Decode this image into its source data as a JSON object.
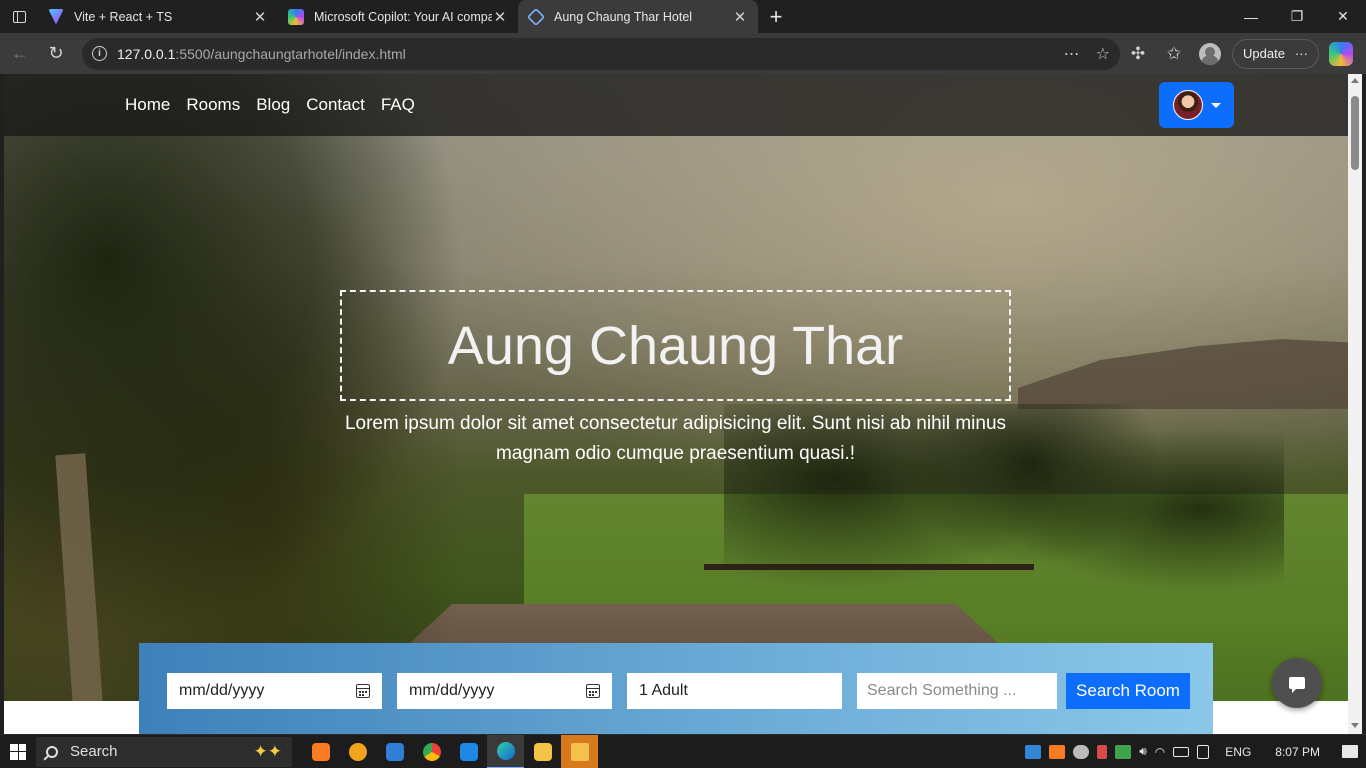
{
  "browser": {
    "tabs": [
      {
        "title": "Vite + React + TS",
        "active": false,
        "icon": "vite-icon"
      },
      {
        "title": "Microsoft Copilot: Your AI compa",
        "active": false,
        "icon": "copilot-icon"
      },
      {
        "title": "Aung Chaung Thar Hotel",
        "active": true,
        "icon": "page-icon"
      }
    ],
    "new_tab_label": "+",
    "url_host": "127.0.0.1",
    "url_path": ":5500/aungchaungtarhotel/index.html",
    "update_label": "Update",
    "more_label": "···"
  },
  "site": {
    "nav": [
      "Home",
      "Rooms",
      "Blog",
      "Contact",
      "FAQ"
    ],
    "hero_title": "Aung Chaung Thar",
    "hero_description": "Lorem ipsum dolor sit amet consectetur adipisicing elit. Sunt nisi ab nihil minus magnam odio cumque praesentium quasi.!",
    "booking": {
      "checkin_placeholder": "mm/dd/yyyy",
      "checkout_placeholder": "mm/dd/yyyy",
      "guests_value": "1 Adult",
      "search_placeholder": "Search Something ...",
      "search_button": "Search Room"
    },
    "colors": {
      "primary": "#0d6efd",
      "booking_gradient_start": "#3e80b9",
      "booking_gradient_end": "#8bc7e8",
      "nav_bg": "#191919"
    }
  },
  "taskbar": {
    "search_label": "Search",
    "language": "ENG",
    "time": "8:07 PM"
  }
}
